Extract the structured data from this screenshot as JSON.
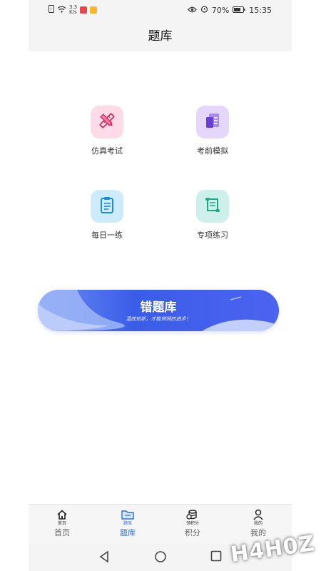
{
  "status_bar": {
    "net_speed_top": "3.3",
    "net_speed_bottom": "K/s",
    "battery": "70%",
    "time": "15:35"
  },
  "header": {
    "title": "题库"
  },
  "tiles": [
    {
      "label": "仿真考试",
      "icon": "pencil-ruler-icon",
      "color": "#ffdbe7"
    },
    {
      "label": "考前模拟",
      "icon": "document-icon",
      "color": "#e4d7fb"
    },
    {
      "label": "每日一练",
      "icon": "clipboard-icon",
      "color": "#cdebfb"
    },
    {
      "label": "专项练习",
      "icon": "scroll-icon",
      "color": "#cdf1ea"
    }
  ],
  "banner": {
    "title": "错题库",
    "subtitle": "温故知新，才能悄悄的进步！"
  },
  "tabs": [
    {
      "small": "首页",
      "label": "首页",
      "icon": "home-icon"
    },
    {
      "small": "题库",
      "label": "题库",
      "icon": "folder-icon"
    },
    {
      "small": "领积分",
      "label": "积分",
      "icon": "coins-icon"
    },
    {
      "small": "我的",
      "label": "我的",
      "icon": "user-icon"
    }
  ],
  "active_tab_color": "#2d6fe0",
  "watermark": "H4H0Z"
}
